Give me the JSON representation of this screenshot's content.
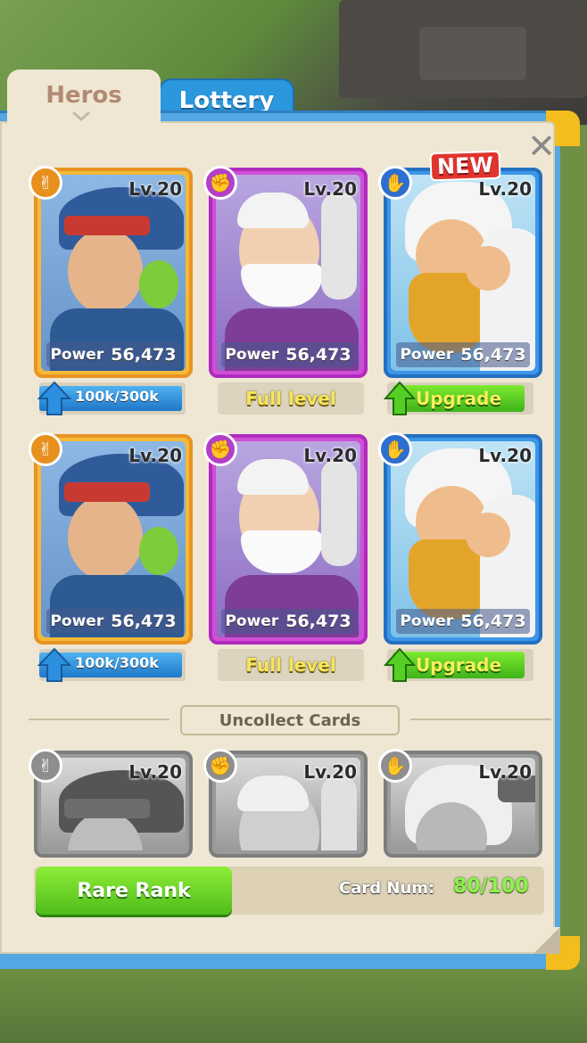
{
  "tabs": [
    {
      "label": "Heros"
    },
    {
      "label": "Lottery"
    }
  ],
  "collected_cards": [
    {
      "level": "Lv.20",
      "power_label": "Power",
      "power": "56,473",
      "rarity_color": "#f5b938",
      "type_icon": "peace-hand-icon",
      "status": "progress",
      "progress_text": "100k/300k",
      "progress_fraction": 0.33
    },
    {
      "level": "Lv.20",
      "power_label": "Power",
      "power": "56,473",
      "rarity_color": "#d04fd6",
      "type_icon": "fist-icon",
      "status": "full",
      "status_text": "Full level"
    },
    {
      "level": "Lv.20",
      "power_label": "Power",
      "power": "56,473",
      "rarity_color": "#3d96e8",
      "type_icon": "open-hand-icon",
      "status": "upgrade",
      "status_text": "Upgrade",
      "new": "NEW"
    },
    {
      "level": "Lv.20",
      "power_label": "Power",
      "power": "56,473",
      "rarity_color": "#f5b938",
      "type_icon": "peace-hand-icon",
      "status": "progress",
      "progress_text": "100k/300k",
      "progress_fraction": 0.33
    },
    {
      "level": "Lv.20",
      "power_label": "Power",
      "power": "56,473",
      "rarity_color": "#d04fd6",
      "type_icon": "fist-icon",
      "status": "full",
      "status_text": "Full level"
    },
    {
      "level": "Lv.20",
      "power_label": "Power",
      "power": "56,473",
      "rarity_color": "#3d96e8",
      "type_icon": "open-hand-icon",
      "status": "upgrade",
      "status_text": "Upgrade"
    }
  ],
  "uncollect": {
    "label": "Uncollect Cards",
    "cards": [
      {
        "level": "Lv.20",
        "type_icon": "peace-hand-icon"
      },
      {
        "level": "Lv.20",
        "type_icon": "fist-icon"
      },
      {
        "level": "Lv.20",
        "type_icon": "open-hand-icon"
      }
    ]
  },
  "footer": {
    "rare_rank_label": "Rare Rank",
    "card_num_label": "Card Num:",
    "card_num_value": "80/100"
  },
  "colors": {
    "panel": "#efe7d4",
    "frame_blue": "#55a7e3",
    "accent_green": "#4fbd1b",
    "accent_gold": "#f2bd1d"
  }
}
